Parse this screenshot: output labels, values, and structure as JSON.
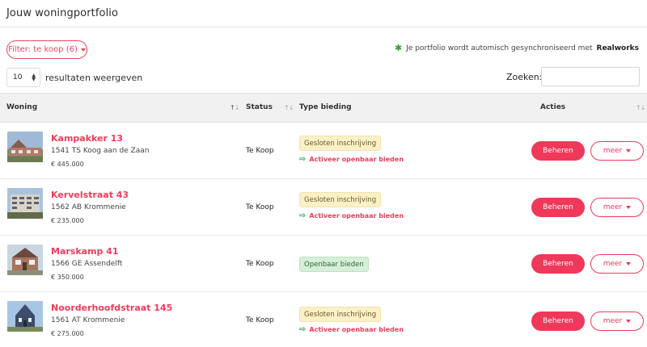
{
  "header": {
    "title": "Jouw woningportfolio"
  },
  "filter": {
    "label": "Filter: te koop (6)"
  },
  "sync": {
    "text": "Je portfolio wordt automisch gesynchroniseerd met",
    "brand": "Realworks"
  },
  "length": {
    "value": "10",
    "suffix": "resultaten weergeven"
  },
  "search": {
    "label": "Zoeken:",
    "value": ""
  },
  "columns": {
    "woning": "Woning",
    "status": "Status",
    "type": "Type bieding",
    "acties": "Acties"
  },
  "actions": {
    "manage": "Beheren",
    "more": "meer",
    "activate": "Activeer openbaar bieden"
  },
  "rows": [
    {
      "name": "Kampakker 13",
      "address": "1541 TS Koog aan de Zaan",
      "price": "€ 445.000",
      "status": "Te Koop",
      "bid_type": "Gesloten inschrijving",
      "show_activate": true
    },
    {
      "name": "Kervelstraat 43",
      "address": "1562 AB Krommenie",
      "price": "€ 235.000",
      "status": "Te Koop",
      "bid_type": "Gesloten inschrijving",
      "show_activate": true
    },
    {
      "name": "Marskamp 41",
      "address": "1566 GE Assendelft",
      "price": "€ 350.000",
      "status": "Te Koop",
      "bid_type": "Openbaar bieden",
      "show_activate": false
    },
    {
      "name": "Noorderhoofdstraat 145",
      "address": "1561 AT Krommenie",
      "price": "€ 275.000",
      "status": "Te Koop",
      "bid_type": "Gesloten inschrijving",
      "show_activate": true
    }
  ],
  "colors": {
    "accent": "#f0385a",
    "sync_icon": "#2e9e3a",
    "closed_badge": "#fbf0c8",
    "open_badge": "#d7efd9"
  },
  "icons": {
    "sync": "bug-icon",
    "activate": "arrow-right-icon"
  }
}
